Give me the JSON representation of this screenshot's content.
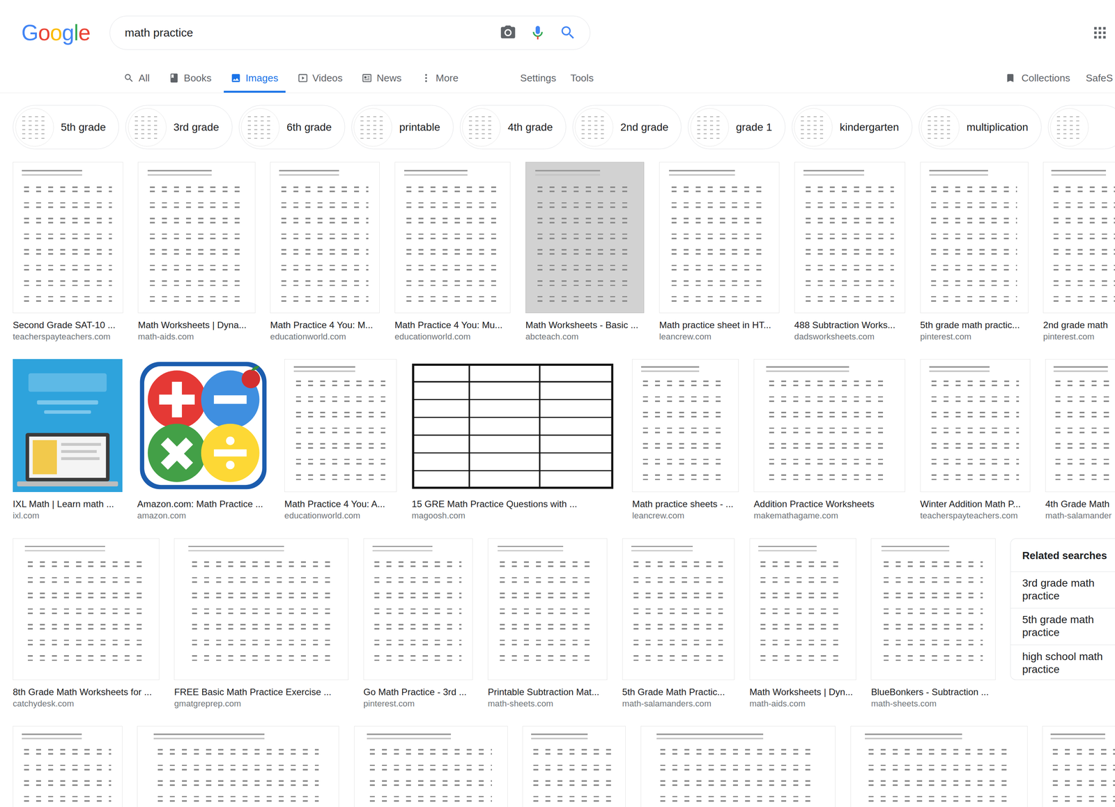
{
  "header": {
    "logo": "Google",
    "query": "math practice"
  },
  "tabs": [
    {
      "label": "All",
      "selected": false
    },
    {
      "label": "Books",
      "selected": false
    },
    {
      "label": "Images",
      "selected": true
    },
    {
      "label": "Videos",
      "selected": false
    },
    {
      "label": "News",
      "selected": false
    },
    {
      "label": "More",
      "selected": false
    }
  ],
  "tools": [
    "Settings",
    "Tools"
  ],
  "right_links": {
    "collections": "Collections",
    "safe_search": "SafeS"
  },
  "chips": [
    {
      "label": "5th grade"
    },
    {
      "label": "3rd grade"
    },
    {
      "label": "6th grade"
    },
    {
      "label": "printable"
    },
    {
      "label": "4th grade"
    },
    {
      "label": "2nd grade"
    },
    {
      "label": "grade 1"
    },
    {
      "label": "kindergarten"
    },
    {
      "label": "multiplication"
    }
  ],
  "results": [
    {
      "items": [
        {
          "title": "Second Grade SAT-10 ...",
          "source": "teacherspayteachers.com",
          "kind": "worksheet"
        },
        {
          "title": "Math Worksheets | Dyna...",
          "source": "math-aids.com",
          "kind": "worksheet"
        },
        {
          "title": "Math Practice 4 You: M...",
          "source": "educationworld.com",
          "kind": "worksheet"
        },
        {
          "title": "Math Practice 4 You: Mu...",
          "source": "educationworld.com",
          "kind": "worksheet"
        },
        {
          "title": "Math Worksheets - Basic ...",
          "source": "abcteach.com",
          "kind": "grey"
        },
        {
          "title": "Math practice sheet in HT...",
          "source": "leancrew.com",
          "kind": "worksheet"
        },
        {
          "title": "488 Subtraction Works...",
          "source": "dadsworksheets.com",
          "kind": "worksheet"
        },
        {
          "title": "5th grade math practic...",
          "source": "pinterest.com",
          "kind": "worksheet"
        },
        {
          "title": "2nd grade math",
          "source": "pinterest.com",
          "kind": "worksheet"
        }
      ]
    },
    {
      "items": [
        {
          "title": "IXL Math | Learn math ...",
          "source": "ixl.com",
          "kind": "ixl"
        },
        {
          "title": "Amazon.com: Math Practice ...",
          "source": "amazon.com",
          "kind": "app"
        },
        {
          "title": "Math Practice 4 You: A...",
          "source": "educationworld.com",
          "kind": "worksheet"
        },
        {
          "title": "15 GRE Math Practice Questions with ...",
          "source": "magoosh.com",
          "kind": "table"
        },
        {
          "title": "Math practice sheets - ...",
          "source": "leancrew.com",
          "kind": "worksheet"
        },
        {
          "title": "Addition Practice Worksheets",
          "source": "makemathagame.com",
          "kind": "worksheet"
        },
        {
          "title": "Winter Addition Math P...",
          "source": "teacherspayteachers.com",
          "kind": "worksheet"
        },
        {
          "title": "4th Grade Math",
          "source": "math-salamander",
          "kind": "worksheet"
        }
      ]
    },
    {
      "items": [
        {
          "title": "8th Grade Math Worksheets for ...",
          "source": "catchydesk.com",
          "kind": "worksheet"
        },
        {
          "title": "FREE Basic Math Practice Exercise ...",
          "source": "gmatgreprep.com",
          "kind": "worksheet"
        },
        {
          "title": "Go Math Practice - 3rd ...",
          "source": "pinterest.com",
          "kind": "worksheet"
        },
        {
          "title": "Printable Subtraction Mat...",
          "source": "math-sheets.com",
          "kind": "worksheet"
        },
        {
          "title": "5th Grade Math Practic...",
          "source": "math-salamanders.com",
          "kind": "worksheet"
        },
        {
          "title": "Math Worksheets | Dyn...",
          "source": "math-aids.com",
          "kind": "worksheet"
        },
        {
          "title": "BlueBonkers - Subtraction ...",
          "source": "math-sheets.com",
          "kind": "worksheet"
        }
      ]
    },
    {
      "items": [
        {
          "kind": "worksheet"
        },
        {
          "kind": "worksheet"
        },
        {
          "kind": "worksheet"
        },
        {
          "kind": "worksheet"
        },
        {
          "kind": "worksheet"
        },
        {
          "kind": "worksheet"
        },
        {
          "kind": "worksheet"
        }
      ]
    }
  ],
  "related": {
    "title": "Related searches",
    "items": [
      "3rd grade math practice",
      "5th grade math practice",
      "high school math practice"
    ]
  }
}
